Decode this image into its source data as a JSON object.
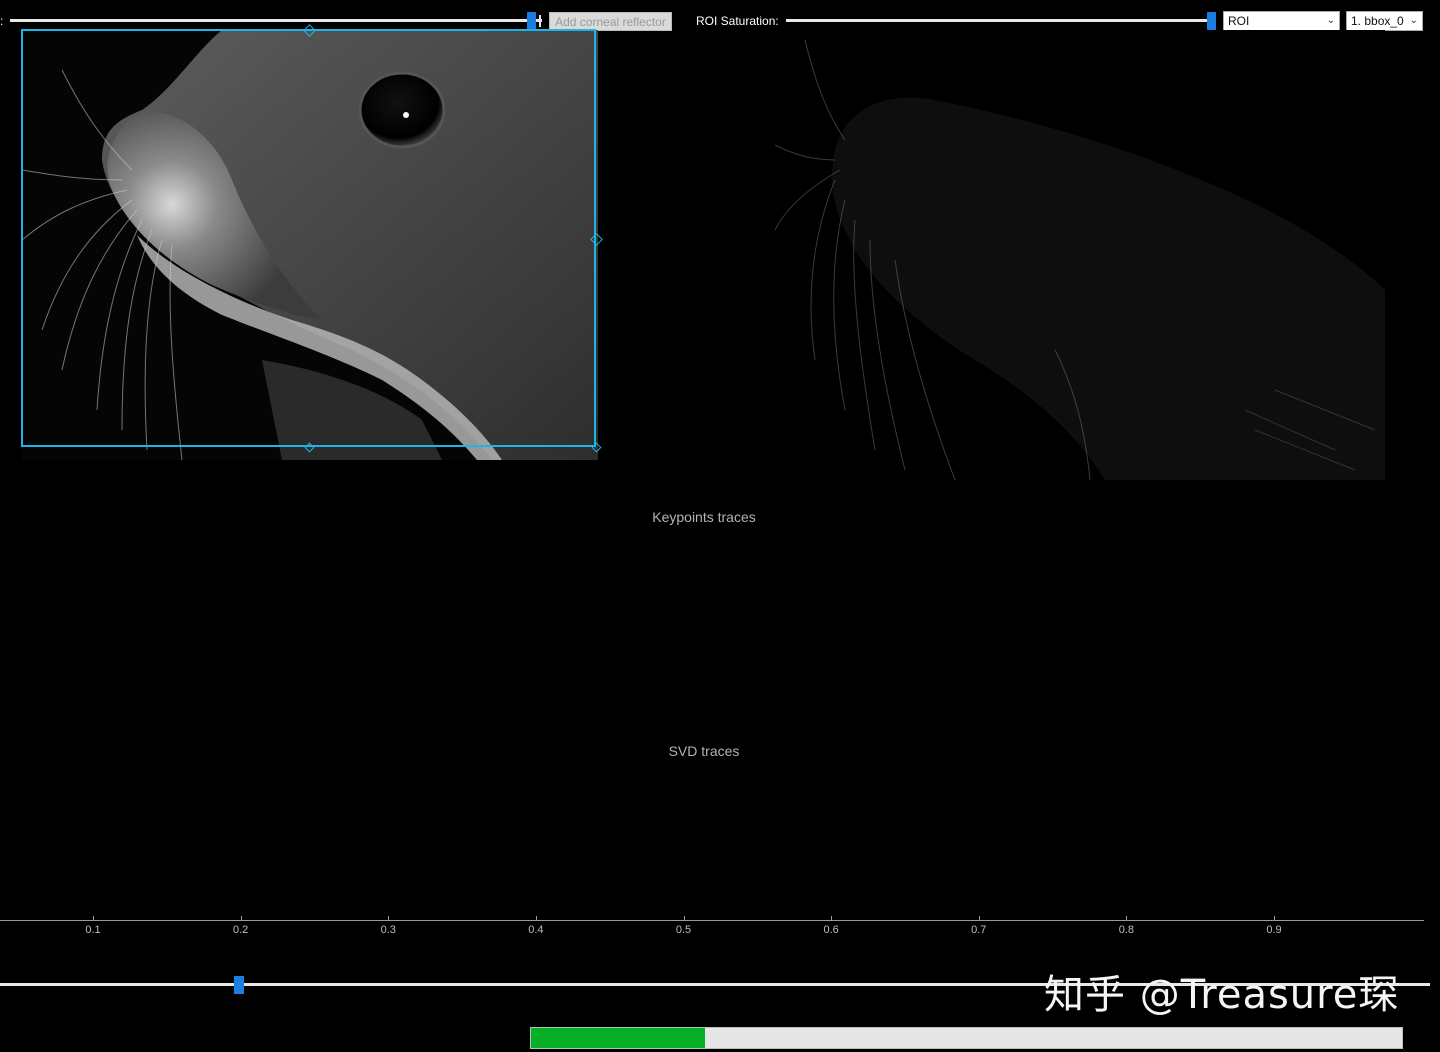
{
  "toolbar": {
    "colon_fragment": ":",
    "saturation_slider_value": 0.98,
    "corneal_button": "Add corneal reflector",
    "roi_saturation_label": "ROI Saturation:",
    "roi_saturation_value": 1.0,
    "roi_type_select": "ROI",
    "bbox_select": "1. bbox_0"
  },
  "plots": {
    "keypoints_title": "Keypoints traces",
    "svd_title": "SVD traces"
  },
  "axis": {
    "ticks": [
      "0.1",
      "0.2",
      "0.3",
      "0.4",
      "0.5",
      "0.6",
      "0.7",
      "0.8",
      "0.9"
    ]
  },
  "frame_slider": {
    "value": 0.165
  },
  "watermark": "知乎 @Treasure琛",
  "progress": {
    "fraction": 0.2,
    "color": "#06b025"
  },
  "colors": {
    "roi": "#1eb4ea",
    "handle": "#1a7fe0"
  }
}
